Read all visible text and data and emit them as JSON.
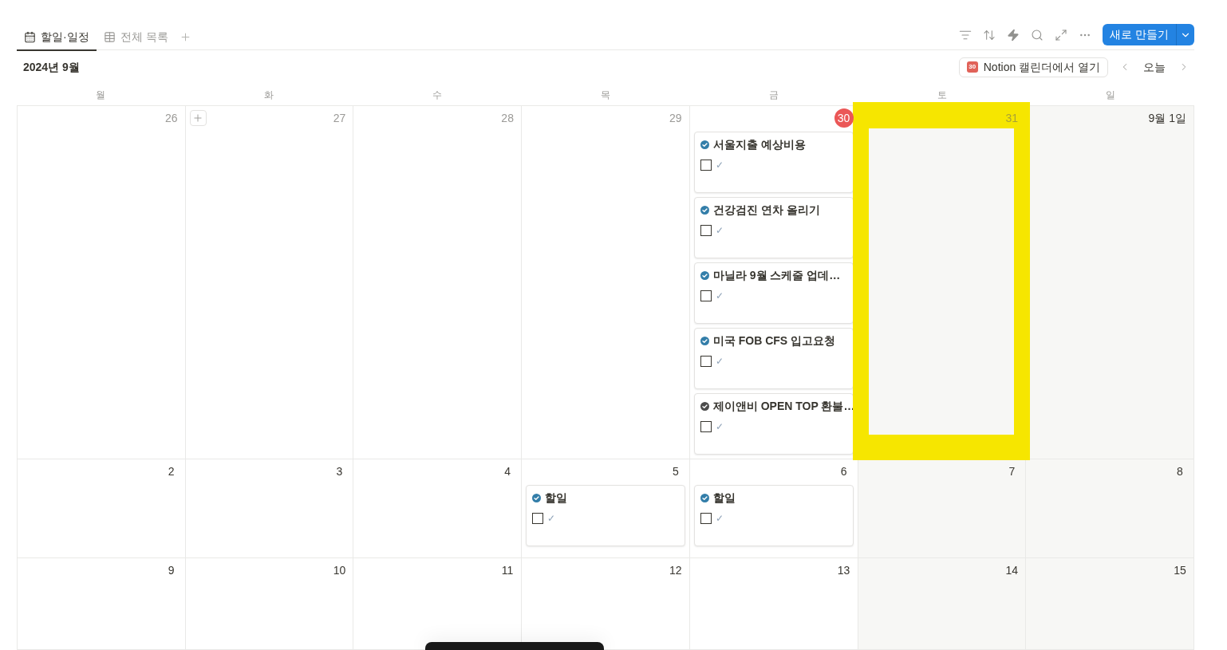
{
  "tabs": [
    {
      "label": "할일·일정",
      "kind": "calendar",
      "selected": true
    },
    {
      "label": "전체 목록",
      "kind": "table",
      "selected": false
    }
  ],
  "toolbar": {
    "new_button": "새로 만들기"
  },
  "header": {
    "month": "2024년 9월",
    "calendar_icon": "30",
    "open_button": "Notion 캘린더에서 열기",
    "today_button": "오늘"
  },
  "weekdays": [
    "월",
    "화",
    "수",
    "목",
    "금",
    "토",
    "일"
  ],
  "weeks": [
    {
      "days": [
        {
          "label": "26",
          "muted": true,
          "today": false,
          "hovered": false,
          "highlight": false
        },
        {
          "label": "27",
          "muted": true,
          "today": false,
          "hovered": true,
          "highlight": false
        },
        {
          "label": "28",
          "muted": true,
          "today": false,
          "hovered": false,
          "highlight": false
        },
        {
          "label": "29",
          "muted": true,
          "today": false,
          "hovered": false,
          "highlight": false
        },
        {
          "label": "30",
          "muted": true,
          "today": true,
          "hovered": false,
          "highlight": false,
          "events": [
            {
              "title": "서울지출 예상비용",
              "color": "#337ea9",
              "checked": false,
              "check_label": "✓"
            },
            {
              "title": "건강검진 연차 올리기",
              "color": "#337ea9",
              "checked": false,
              "check_label": "✓"
            },
            {
              "title": "마닐라 9월 스케줄 업데…",
              "color": "#337ea9",
              "checked": false,
              "check_label": "✓"
            },
            {
              "title": "미국 FOB CFS 입고요청",
              "color": "#337ea9",
              "checked": false,
              "check_label": "✓"
            },
            {
              "title": "제이앤비 OPEN TOP 환불…",
              "color": "#4b4b4b",
              "checked": false,
              "check_label": "✓"
            }
          ]
        },
        {
          "label": "31",
          "muted": true,
          "today": false,
          "hovered": false,
          "highlight": true
        },
        {
          "label": "9월 1일",
          "muted": false,
          "today": false,
          "hovered": false,
          "highlight": false
        }
      ]
    },
    {
      "days": [
        {
          "label": "2",
          "muted": false,
          "today": false,
          "hovered": false,
          "highlight": false
        },
        {
          "label": "3",
          "muted": false,
          "today": false,
          "hovered": false,
          "highlight": false
        },
        {
          "label": "4",
          "muted": false,
          "today": false,
          "hovered": false,
          "highlight": false
        },
        {
          "label": "5",
          "muted": false,
          "today": false,
          "hovered": false,
          "highlight": false,
          "events": [
            {
              "title": "할일",
              "color": "#337ea9",
              "checked": false,
              "check_label": "✓"
            }
          ]
        },
        {
          "label": "6",
          "muted": false,
          "today": false,
          "hovered": false,
          "highlight": false,
          "events": [
            {
              "title": "할일",
              "color": "#337ea9",
              "checked": false,
              "check_label": "✓"
            }
          ]
        },
        {
          "label": "7",
          "muted": false,
          "today": false,
          "hovered": false,
          "highlight": false
        },
        {
          "label": "8",
          "muted": false,
          "today": false,
          "hovered": false,
          "highlight": false
        }
      ]
    },
    {
      "days": [
        {
          "label": "9",
          "muted": false,
          "today": false,
          "hovered": false,
          "highlight": false
        },
        {
          "label": "10",
          "muted": false,
          "today": false,
          "hovered": false,
          "highlight": false
        },
        {
          "label": "11",
          "muted": false,
          "today": false,
          "hovered": false,
          "highlight": false
        },
        {
          "label": "12",
          "muted": false,
          "today": false,
          "hovered": false,
          "highlight": false
        },
        {
          "label": "13",
          "muted": false,
          "today": false,
          "hovered": false,
          "highlight": false
        },
        {
          "label": "14",
          "muted": false,
          "today": false,
          "hovered": false,
          "highlight": false
        },
        {
          "label": "15",
          "muted": false,
          "today": false,
          "hovered": false,
          "highlight": false
        }
      ]
    }
  ]
}
